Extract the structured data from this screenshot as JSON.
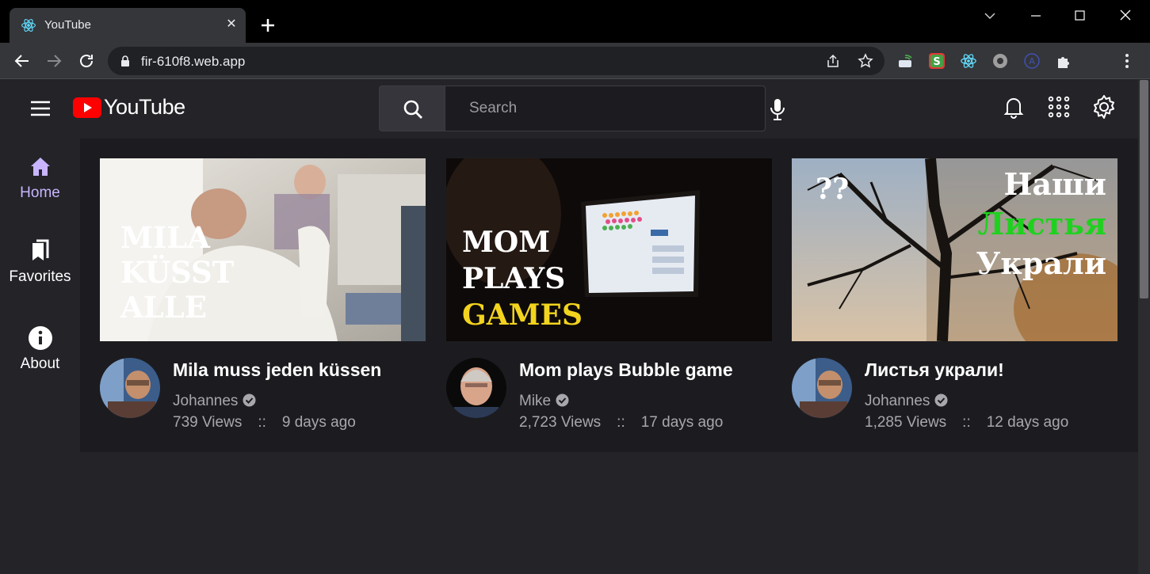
{
  "browser": {
    "tab_title": "YouTube",
    "url": "fir-610f8.web.app",
    "icons": [
      "react-icon",
      "close-icon",
      "plus-icon",
      "back-arrow-icon",
      "forward-arrow-icon",
      "reload-icon",
      "lock-icon",
      "share-icon",
      "star-icon",
      "puzzle-icon",
      "more-vertical-icon"
    ]
  },
  "header": {
    "brand": "YouTube",
    "search_placeholder": "Search",
    "brand_color": "#ff0000"
  },
  "sidebar": {
    "items": [
      {
        "label": "Home",
        "icon": "home-icon",
        "active": true
      },
      {
        "label": "Favorites",
        "icon": "bookmarks-icon",
        "active": false
      },
      {
        "label": "About",
        "icon": "info-icon",
        "active": false
      }
    ],
    "active_color": "#c9b5ff"
  },
  "videos": [
    {
      "thumb_text": [
        "MILA",
        "KÜSST",
        "ALLE"
      ],
      "title": "Mila muss jeden küssen",
      "channel": "Johannes",
      "views": "739 Views",
      "separator": "::",
      "age": "9 days ago"
    },
    {
      "thumb_text": [
        "MOM",
        "PLAYS",
        "GAMES"
      ],
      "title": "Mom plays Bubble game",
      "channel": "Mike",
      "views": "2,723 Views",
      "separator": "::",
      "age": "17 days ago"
    },
    {
      "thumb_text": [
        "??",
        "Наши",
        "Листья",
        "Украли"
      ],
      "title": "Листья украли!",
      "channel": "Johannes",
      "views": "1,285 Views",
      "separator": "::",
      "age": "12 days ago"
    }
  ]
}
